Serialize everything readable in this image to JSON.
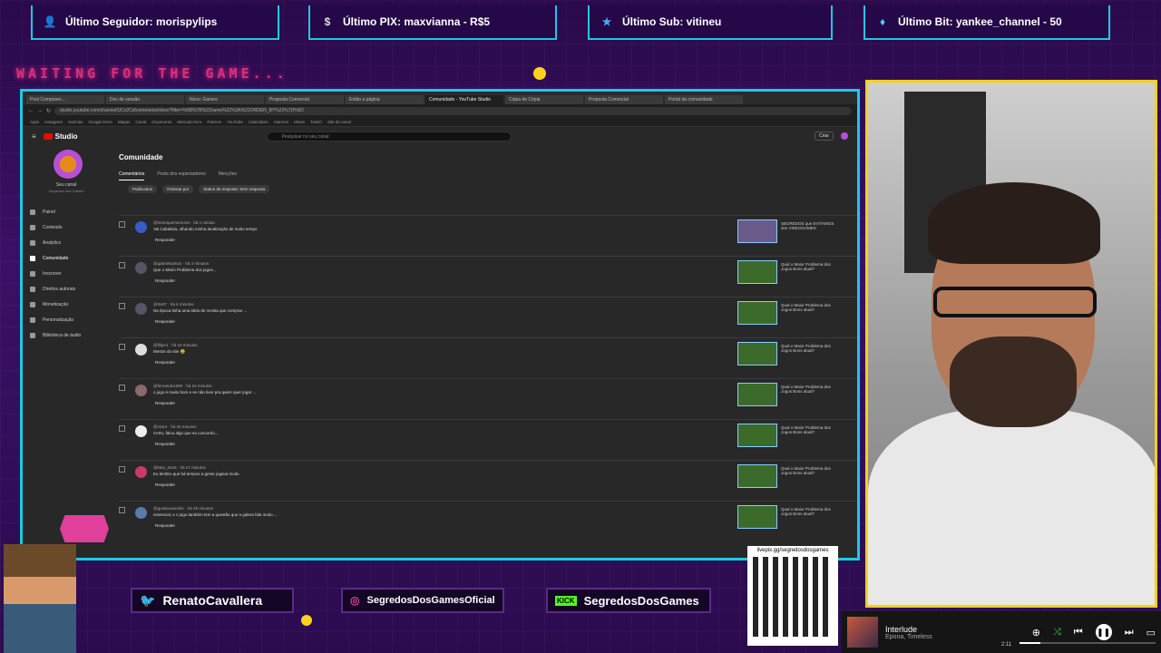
{
  "alerts": [
    {
      "icon": "person-icon",
      "label": "Último Seguidor: morispylips"
    },
    {
      "icon": "dollar-icon",
      "label": "Último PIX: maxvianna - R$5"
    },
    {
      "icon": "star-icon",
      "label": "Último Sub: vitineu"
    },
    {
      "icon": "diamond-icon",
      "label": "Último Bit: yankee_channel - 50"
    }
  ],
  "waiting_text": "WAITING FOR THE GAME...",
  "browser": {
    "tabs": [
      "Post Composer...",
      "Doc de sessão",
      "Novo: Games",
      "Proposta Comercial",
      "Então a página",
      "Comunidade - YouTube Studio",
      "Cópia de Cópia",
      "Proposta Comercial",
      "Portal da comunidade"
    ],
    "active_tab": 5,
    "url": "studio.youtube.com/channel/UCx2Cd/comments/inbox?filter=%5B%7B%22name%22%3A%22ORDER_BY%22%7D%5D",
    "bookmarks": [
      "Apps",
      "Instagram",
      "Notícias",
      "Google Drive",
      "Mapas",
      "Canal",
      "Orçamento",
      "Mercado livre",
      "Patreon",
      "YouTube",
      "Calendário",
      "Alarmes",
      "Ideias",
      "Twitch",
      "Site do canal"
    ]
  },
  "studio": {
    "logo": "Studio",
    "search_placeholder": "Pesquisar no seu canal",
    "create_label": "Criar",
    "channel_name": "Seu canal",
    "channel_sub": "Segredos dos Games",
    "nav": [
      "Painel",
      "Conteúdo",
      "Analytics",
      "Comunidade",
      "Inscrever",
      "Direitos autorais",
      "Monetização",
      "Personalização",
      "Biblioteca de áudio"
    ],
    "active_nav": 3,
    "page_title": "Comunidade",
    "subtabs": [
      "Comentários",
      "Posts dos espectadores",
      "Menções"
    ],
    "filters": [
      "Publicados",
      "Ordenar por",
      "Status de resposta: Sem resposta"
    ],
    "reply_label": "Responder",
    "comments": [
      {
        "author": "@henriquemenezes · há 1 minuto",
        "text": "Vai Cabalista, olhando minha atualização de muito tempo",
        "video": "SEGREDOS que EVITAMOS dos VIDEOGAMES"
      },
      {
        "author": "@gabrielsantos · há 4 minutos",
        "text": "Que o Mario Problema dos jogos...",
        "video": "Qual o Maior Problema dos Jogos Bons atual?"
      },
      {
        "author": "@rte07 · há 6 minutos",
        "text": "Na época tinha uma ideia de revista que comprar ...",
        "video": "Qual o Maior Problema dos Jogos Bons atual?"
      },
      {
        "author": "@filipe1 · há 10 minutos",
        "text": "Mestre do site 😃",
        "video": "Qual o Maior Problema dos Jogos Bons atual?"
      },
      {
        "author": "@fernando1050 · há 24 minutos",
        "text": "o jogo é muito bom e se não tiver pra quem quer jogar ...",
        "video": "Qual o Maior Problema dos Jogos Bons atual?"
      },
      {
        "author": "@victor · há 26 minutos",
        "text": "Certo, falou algo que eu concordo...",
        "video": "Qual o Maior Problema dos Jogos Bons atual?"
      },
      {
        "author": "@kato_0445 · há 27 minutos",
        "text": "Eu lembro que há tempos a gente jogava muito",
        "video": "Qual o Maior Problema dos Jogos Bons atual?"
      },
      {
        "author": "@gustavoaurelio · há 45 minutos",
        "text": "essencial, e o jogo também tem a questão que a galera fala muito ...",
        "video": "Qual o Maior Problema dos Jogos Bons atual?"
      }
    ]
  },
  "socials": [
    {
      "icon": "twitter-icon",
      "label": "RenatoCavallera"
    },
    {
      "icon": "instagram-icon",
      "label": "SegredosDosGamesOficial"
    },
    {
      "icon": "kick-icon",
      "label": "SegredosDosGames"
    }
  ],
  "qr_label": "livepix.gg/segredosdosgames",
  "music": {
    "title": "Interlude",
    "artist": "Epona, Timeless",
    "time": "2:11",
    "progress": 0.15
  }
}
